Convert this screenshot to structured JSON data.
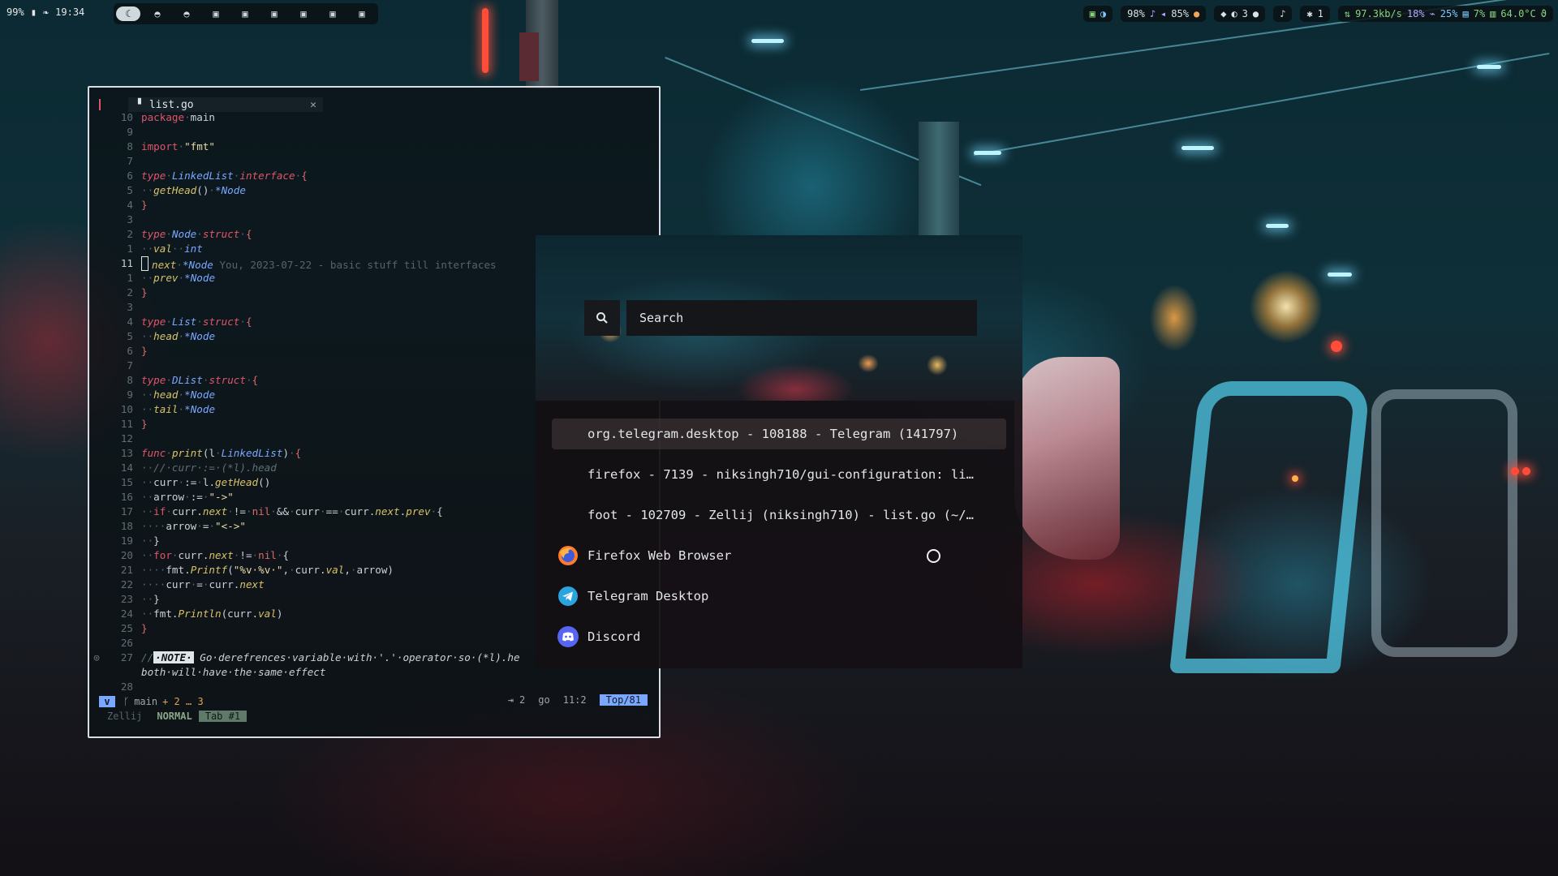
{
  "topbar": {
    "battery": "99%",
    "clock": "19:34",
    "workspaces": [
      "1",
      "2",
      "3",
      "4",
      "5",
      "6",
      "7",
      "8",
      "9"
    ],
    "cpu_temp_label": "98%",
    "volume": "85%",
    "notif_count": "3",
    "bluetooth": "1",
    "net_speed": "97.3kb/s",
    "cpu": "18%",
    "mem": "25%",
    "disk": "7%",
    "temp": "64.0°C"
  },
  "editor": {
    "tab_title": "list.go",
    "status": {
      "mode_glyph": "v",
      "branch": "main",
      "changes": "+ 2 … 3",
      "tabsize": "⇥ 2",
      "filetype": "go",
      "cursor": "11:2",
      "position": "Top/81"
    },
    "zellij": {
      "name": "Zellij",
      "mode": "NORMAL",
      "tab": "Tab #1"
    }
  },
  "launcher": {
    "search_placeholder": "Search",
    "results": [
      {
        "label": "org.telegram.desktop - 108188 - Telegram (141797)",
        "icon": "none",
        "selected": true
      },
      {
        "label": "firefox - 7139 - niksingh710/gui-configuration: li…",
        "icon": "none",
        "selected": false
      },
      {
        "label": "foot - 102709 - Zellij (niksingh710) - list.go (~/…",
        "icon": "none",
        "selected": false
      },
      {
        "label": "Firefox Web Browser",
        "icon": "firefox-icon",
        "selected": false
      },
      {
        "label": "Telegram Desktop",
        "icon": "telegram-icon",
        "selected": false
      },
      {
        "label": "Discord",
        "icon": "discord-icon",
        "selected": false
      }
    ]
  },
  "colors": {
    "accent_blue": "#7aa7ff",
    "keyword_red": "#e0556a",
    "func_yellow": "#d7c26a"
  }
}
